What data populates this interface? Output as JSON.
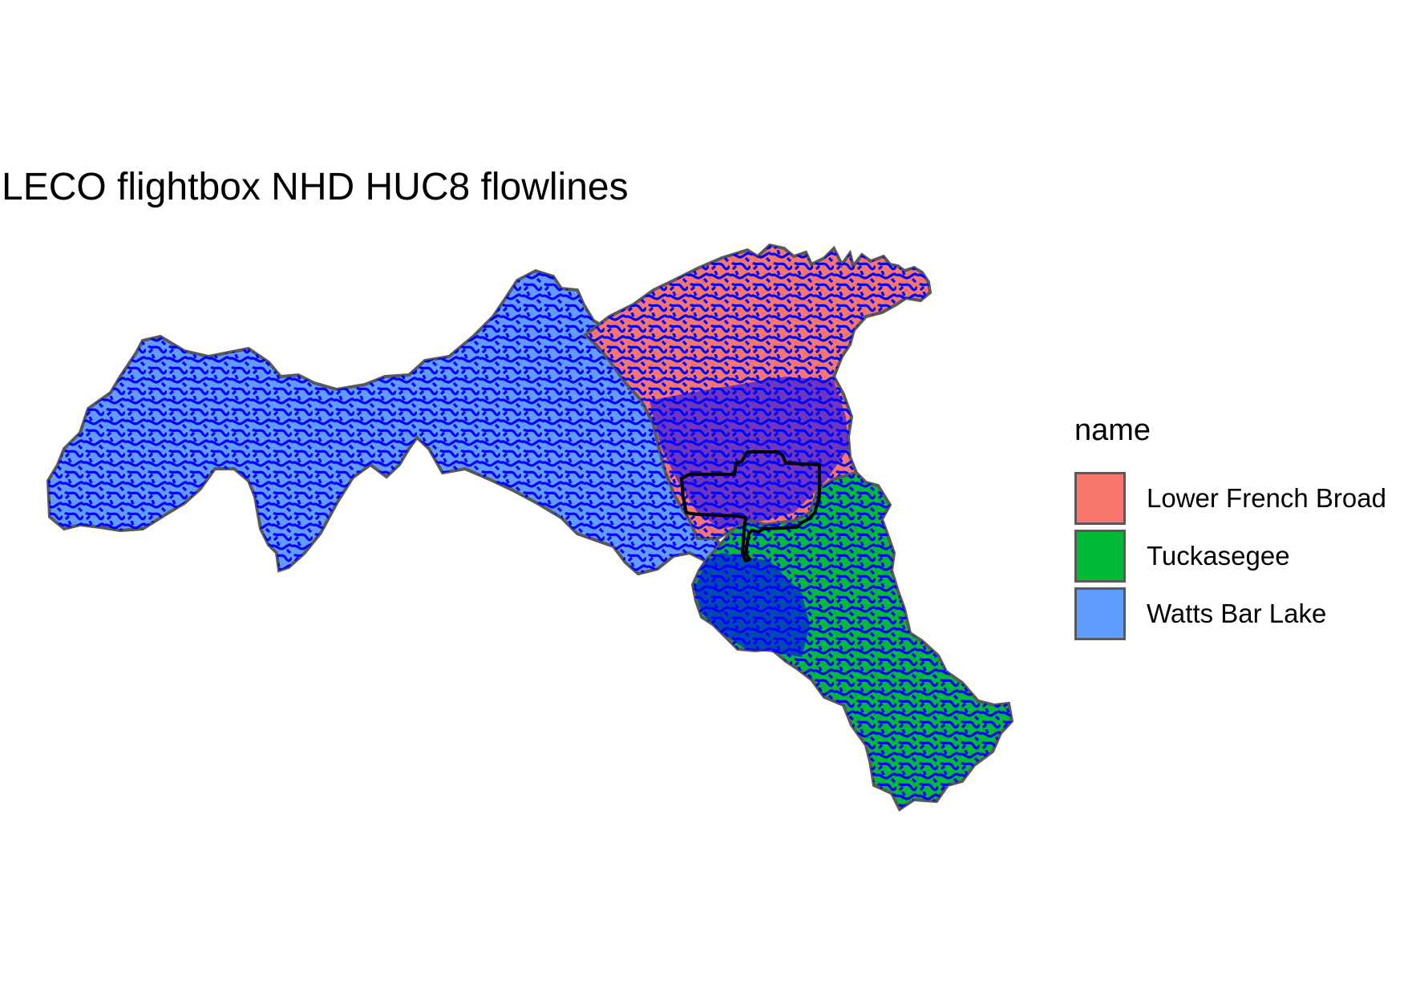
{
  "title": "LECO flightbox NHD HUC8 flowlines",
  "legend": {
    "title": "name",
    "items": [
      {
        "label": "Lower French Broad",
        "color": "#F8766D"
      },
      {
        "label": "Tuckasegee",
        "color": "#00BA38"
      },
      {
        "label": "Watts Bar Lake",
        "color": "#619CFF"
      }
    ]
  },
  "colors": {
    "flowlines": "#0000FF",
    "basin_outline": "#595959",
    "flightbox_outline": "#000000",
    "background": "#FFFFFF"
  }
}
